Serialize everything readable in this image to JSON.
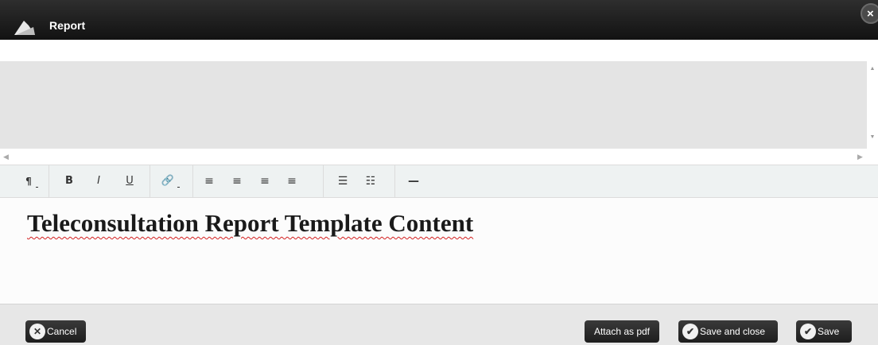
{
  "window": {
    "title": "Report",
    "close_glyph": "×"
  },
  "scroll": {
    "up": "▲",
    "down": "▼",
    "left": "◀",
    "right": "▶"
  },
  "toolbar": {
    "format": "¶",
    "bold": "B",
    "italic": "I",
    "underline": "U",
    "link": "🔗",
    "align_left": "≡",
    "align_center": "≡",
    "align_right": "≡",
    "justify": "≡",
    "bullet_list": "☰",
    "numbered_list": "☷",
    "horizontal_rule": "—"
  },
  "editor": {
    "content": "Teleconsultation Report Template Content"
  },
  "footer": {
    "cancel_label": "Cancel",
    "cancel_icon": "✕",
    "attach_pdf_label": "Attach as pdf",
    "save_close_label": "Save and close",
    "save_label": "Save",
    "check_icon": "✔"
  }
}
